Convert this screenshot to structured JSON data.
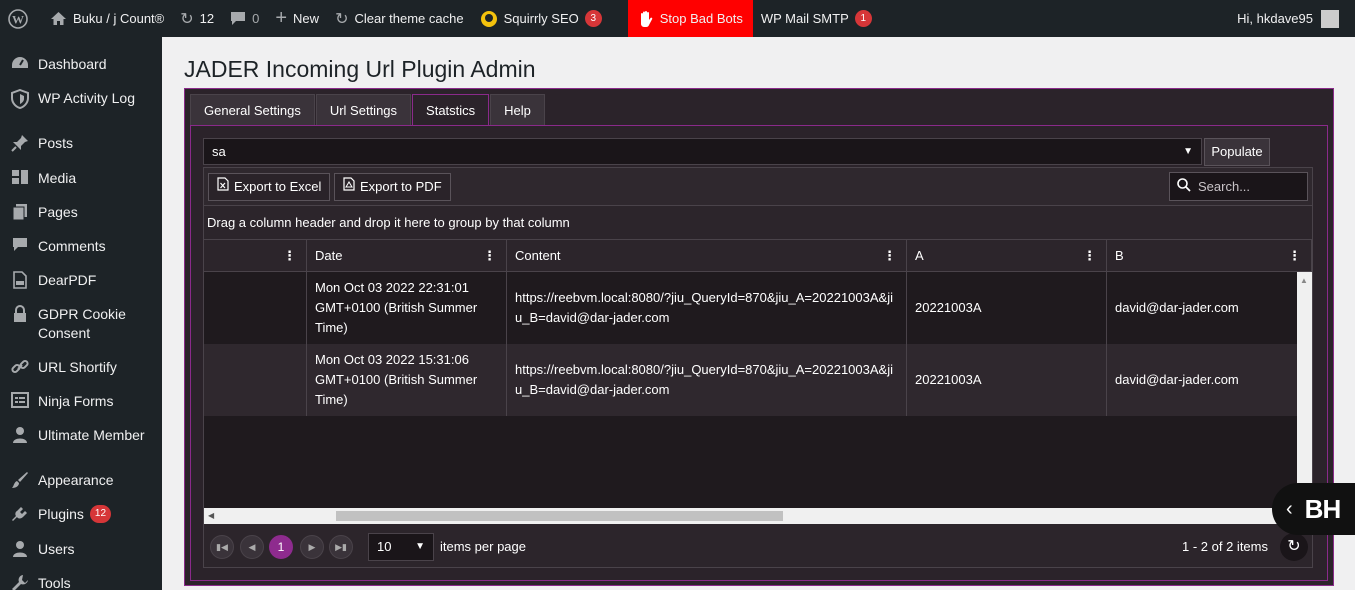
{
  "adminbar": {
    "site_name": "Buku / j Count®",
    "updates_count": "12",
    "comments_count": "0",
    "new_label": "New",
    "clear_cache_label": "Clear theme cache",
    "squirrly_label": "Squirrly SEO",
    "squirrly_badge": "3",
    "stop_bad_bots_label": "Stop Bad Bots",
    "wp_mail_label": "WP Mail SMTP",
    "wp_mail_badge": "1",
    "greeting": "Hi, hkdave95",
    "icons": [
      "wordpress-logo-icon",
      "home-icon",
      "updates-icon",
      "comment-icon",
      "plus-icon",
      "refresh-icon",
      "squirrly-icon",
      "stop-hand-icon"
    ]
  },
  "sidebar": {
    "items": [
      {
        "label": "Dashboard",
        "icon": "dashboard-icon"
      },
      {
        "label": "WP Activity Log",
        "icon": "shield-icon"
      },
      {
        "label": "Posts",
        "icon": "pin-icon"
      },
      {
        "label": "Media",
        "icon": "media-icon"
      },
      {
        "label": "Pages",
        "icon": "pages-icon"
      },
      {
        "label": "Comments",
        "icon": "comment-icon"
      },
      {
        "label": "DearPDF",
        "icon": "pdf-icon"
      },
      {
        "label": "GDPR Cookie Consent",
        "icon": "lock-icon"
      },
      {
        "label": "URL Shortify",
        "icon": "link-icon"
      },
      {
        "label": "Ninja Forms",
        "icon": "forms-icon"
      },
      {
        "label": "Ultimate Member",
        "icon": "user-icon"
      },
      {
        "label": "Appearance",
        "icon": "brush-icon"
      },
      {
        "label": "Plugins",
        "icon": "plug-icon",
        "badge": "12"
      },
      {
        "label": "Users",
        "icon": "user-icon"
      },
      {
        "label": "Tools",
        "icon": "wrench-icon"
      }
    ]
  },
  "page": {
    "title": "JADER Incoming Url Plugin Admin",
    "tabs": [
      "General Settings",
      "Url Settings",
      "Statstics",
      "Help"
    ],
    "active_tab": "Statstics"
  },
  "combo": {
    "value": "sa",
    "populate_label": "Populate"
  },
  "grid": {
    "export_excel": "Export to Excel",
    "export_pdf": "Export to PDF",
    "search_placeholder": "Search...",
    "group_hint": "Drag a column header and drop it here to group by that column",
    "columns": [
      "",
      "Date",
      "Content",
      "A",
      "B"
    ],
    "rows": [
      {
        "date": "Mon Oct 03 2022 22:31:01 GMT+0100 (British Summer Time)",
        "content": "https://reebvm.local:8080/?jiu_QueryId=870&jiu_A=20221003A&jiu_B=david@dar-jader.com",
        "a": "20221003A",
        "b": "david@dar-jader.com"
      },
      {
        "date": "Mon Oct 03 2022 15:31:06 GMT+0100 (British Summer Time)",
        "content": "https://reebvm.local:8080/?jiu_QueryId=870&jiu_A=20221003A&jiu_B=david@dar-jader.com",
        "a": "20221003A",
        "b": "david@dar-jader.com"
      }
    ],
    "pager": {
      "current_page": "1",
      "page_size": "10",
      "items_per_page_label": "items per page",
      "info": "1 - 2 of 2 items"
    }
  },
  "badge": {
    "text": "BH"
  },
  "colors": {
    "adminbar_bg": "#1d2327",
    "accent": "#8e2b8e",
    "alert_red": "#ff0000",
    "badge_red": "#d63638",
    "panel_bg": "#2b232a"
  }
}
